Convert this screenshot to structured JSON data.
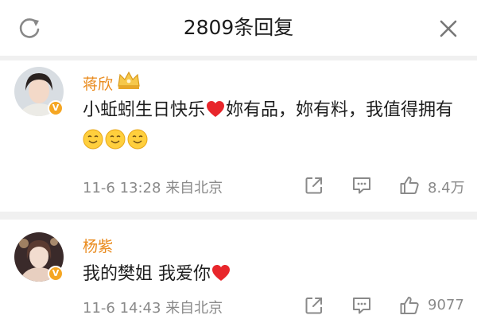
{
  "header": {
    "title": "2809条回复",
    "refresh_icon": "refresh-icon",
    "close_icon": "close-icon"
  },
  "comments": [
    {
      "author": "蒋欣",
      "badge_icon": "verified-badge-icon",
      "crown_icon": "crown-badge-icon",
      "text_part1": "小蚯蚓生日快乐",
      "text_part2": "妳有品，妳有料，我值得拥有",
      "emoji_icons": [
        "heart-icon",
        "smile-emoji-icon",
        "smile-emoji-icon",
        "smile-emoji-icon"
      ],
      "time": "11-6 13:28",
      "location": "来自北京",
      "like_count": "8.4万"
    },
    {
      "author": "杨紫",
      "badge_icon": "verified-badge-icon",
      "text_part1": "我的樊姐 我爱你",
      "emoji_icons": [
        "heart-icon"
      ],
      "time": "11-6 14:43",
      "location": "来自北京",
      "like_count": "9077"
    }
  ],
  "colors": {
    "author_name": "#e98a1c",
    "meta_text": "#8a8a8a",
    "heart": "#e8262b",
    "badge": "#f5a623",
    "page_bg": "#f0f0f0"
  }
}
